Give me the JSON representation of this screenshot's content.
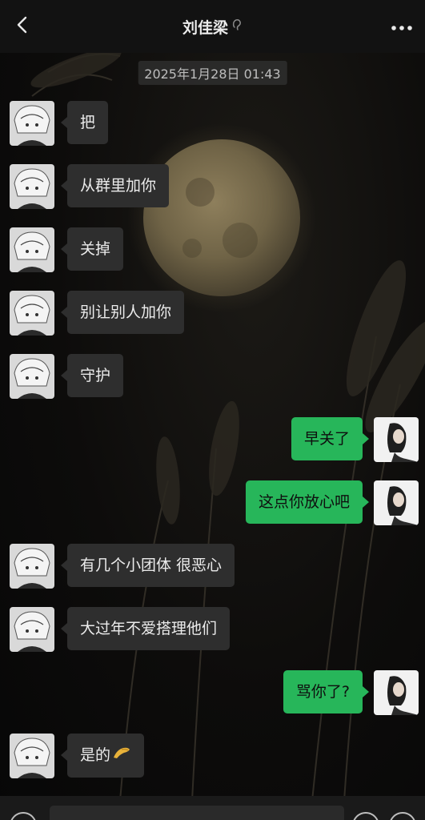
{
  "header": {
    "title": "刘佳梁",
    "back_icon": "chevron-left-icon",
    "more_icon": "more-dots-icon",
    "status_icon": "ear-icon"
  },
  "timestamp": "2025年1月28日 01:43",
  "messages": [
    {
      "side": "left",
      "text": "把"
    },
    {
      "side": "left",
      "text": "从群里加你"
    },
    {
      "side": "left",
      "text": "关掉"
    },
    {
      "side": "left",
      "text": "别让别人加你"
    },
    {
      "side": "left",
      "text": "守护"
    },
    {
      "side": "right",
      "text": "早关了"
    },
    {
      "side": "right",
      "text": "这点你放心吧"
    },
    {
      "side": "left",
      "text": "有几个小团体 很恶心"
    },
    {
      "side": "left",
      "text": "大过年不爱搭理他们"
    },
    {
      "side": "right",
      "text": "骂你了?"
    },
    {
      "side": "left",
      "text": "是的",
      "emoji": "pinched-fingers-emoji"
    }
  ],
  "bottom_bar": {
    "voice_icon": "voice-icon",
    "emoji_icon": "emoji-icon",
    "plus_icon": "plus-icon",
    "input_value": ""
  },
  "colors": {
    "sent_bubble": "#27b65a",
    "received_bubble": "#2e2e2e",
    "topbar": "#121212"
  }
}
